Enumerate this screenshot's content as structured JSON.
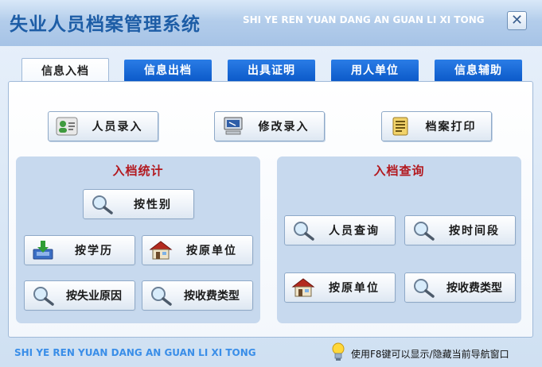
{
  "window": {
    "title": "失业人员档案管理系统",
    "subtitle": "SHI YE REN YUAN DANG AN GUAN LI XI TONG",
    "close_symbol": "✕"
  },
  "tabs": [
    {
      "label": "信息入档",
      "active": true
    },
    {
      "label": "信息出档",
      "active": false
    },
    {
      "label": "出具证明",
      "active": false
    },
    {
      "label": "用人单位",
      "active": false
    },
    {
      "label": "信息辅助",
      "active": false
    }
  ],
  "toolbar": {
    "person_entry": {
      "label": "人员录入",
      "icon": "person-card-icon"
    },
    "modify_entry": {
      "label": "修改录入",
      "icon": "computer-icon"
    },
    "print_archive": {
      "label": "档案打印",
      "icon": "document-scroll-icon"
    }
  },
  "stats_group": {
    "title": "入档统计",
    "by_gender": {
      "label": "按性别",
      "icon": "magnifier-icon"
    },
    "by_education": {
      "label": "按学历",
      "icon": "inbox-download-icon"
    },
    "by_original_unit": {
      "label": "按原单位",
      "icon": "house-icon"
    },
    "by_unemployment_reason": {
      "label": "按失业原因",
      "icon": "magnifier-icon"
    },
    "by_fee_type": {
      "label": "按收费类型",
      "icon": "magnifier-icon"
    }
  },
  "query_group": {
    "title": "入档查询",
    "person_query": {
      "label": "人员查询",
      "icon": "magnifier-icon"
    },
    "by_time_period": {
      "label": "按时间段",
      "icon": "magnifier-icon"
    },
    "by_original_unit": {
      "label": "按原单位",
      "icon": "house-icon"
    },
    "by_fee_type": {
      "label": "按收费类型",
      "icon": "magnifier-icon"
    }
  },
  "footer": {
    "pinyin": "SHI YE REN YUAN DANG AN GUAN LI XI TONG",
    "hint": "使用F8键可以显示/隐藏当前导航窗口"
  }
}
